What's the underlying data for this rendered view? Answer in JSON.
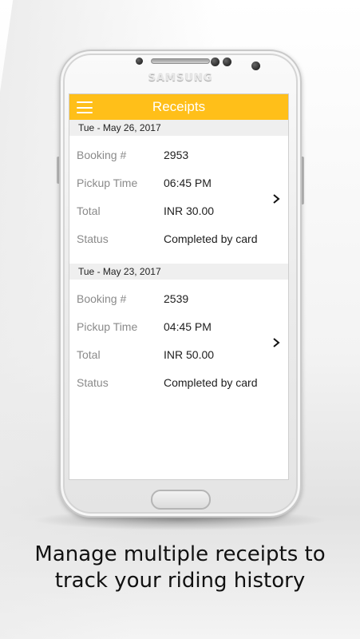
{
  "header": {
    "title": "Receipts"
  },
  "receipts": [
    {
      "date": "Tue -  May 26, 2017",
      "rows": [
        {
          "label": "Booking #",
          "value": "2953"
        },
        {
          "label": "Pickup Time",
          "value": "06:45 PM"
        },
        {
          "label": "Total",
          "value": "INR 30.00"
        },
        {
          "label": "Status",
          "value": "Completed by card"
        }
      ]
    },
    {
      "date": "Tue -  May 23, 2017",
      "rows": [
        {
          "label": "Booking #",
          "value": "2539"
        },
        {
          "label": "Pickup Time",
          "value": "04:45 PM"
        },
        {
          "label": "Total",
          "value": "INR 50.00"
        },
        {
          "label": "Status",
          "value": "Completed by card"
        }
      ]
    }
  ],
  "device": {
    "brand": "SAMSUNG"
  },
  "caption": {
    "line1": "Manage multiple receipts to",
    "line2": "track your riding history"
  },
  "colors": {
    "accent": "#ffbf19",
    "date_bar": "#efefef",
    "label": "#8a8a8a"
  },
  "icons": {
    "menu": "hamburger-menu-icon",
    "chevron": "chevron-right-icon"
  }
}
